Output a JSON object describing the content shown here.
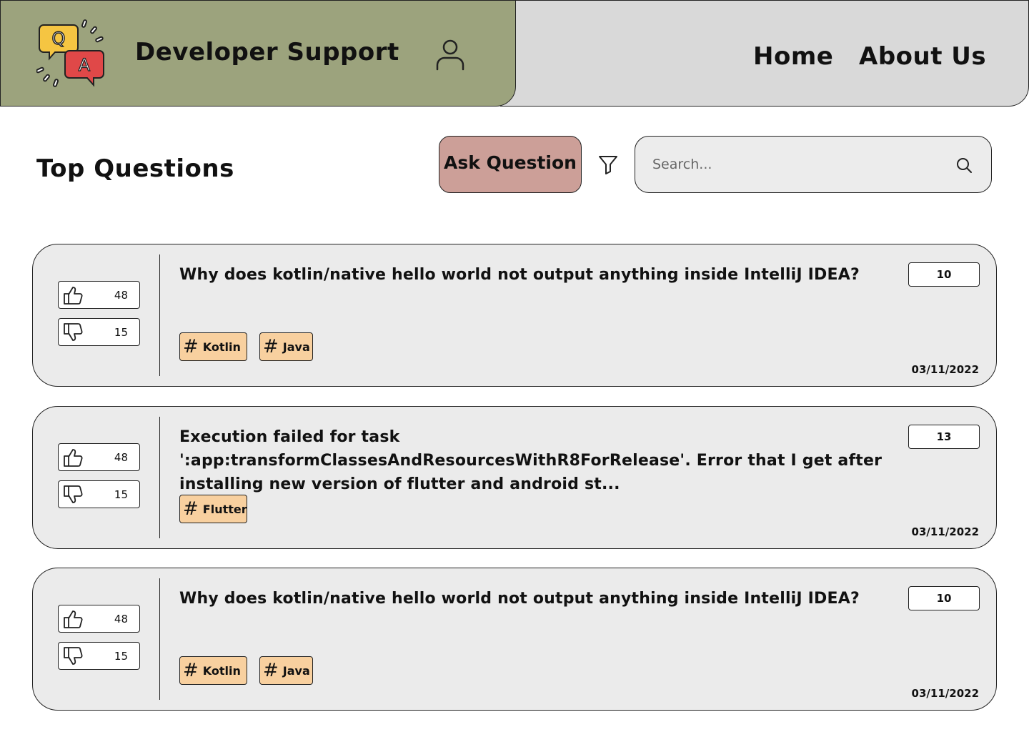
{
  "header": {
    "app_title": "Developer Support",
    "logo": {
      "letters": [
        "Q",
        "A"
      ],
      "colors": {
        "q_bubble": "#f5c542",
        "a_bubble": "#e04848"
      }
    },
    "nav": {
      "home": "Home",
      "about": "About Us"
    },
    "colors": {
      "left_bg": "#9ca37d",
      "right_bg": "#d9d9d9"
    }
  },
  "toolbar": {
    "section_title": "Top Questions",
    "ask_button": "Ask Question",
    "search_placeholder": "Search...",
    "colors": {
      "ask_button_bg": "#cc9f98",
      "search_bg": "#ececec"
    }
  },
  "questions": [
    {
      "title": "Why does kotlin/native hello world not output anything inside IntelliJ IDEA?",
      "upvotes": "48",
      "downvotes": "15",
      "answers": "10",
      "tags": [
        "Kotlin",
        "Java"
      ],
      "date": "03/11/2022"
    },
    {
      "title": "Execution failed for task ':app:transformClassesAndResourcesWithR8ForRelease'. Error that I get after installing new version of flutter and android st...",
      "upvotes": "48",
      "downvotes": "15",
      "answers": "13",
      "tags": [
        "Flutter"
      ],
      "date": "03/11/2022"
    },
    {
      "title": "Why does kotlin/native hello world not output anything inside IntelliJ IDEA?",
      "upvotes": "48",
      "downvotes": "15",
      "answers": "10",
      "tags": [
        "Kotlin",
        "Java"
      ],
      "date": "03/11/2022"
    }
  ],
  "colors": {
    "card_bg": "#ebebeb",
    "tag_bg": "#f8d09f"
  }
}
